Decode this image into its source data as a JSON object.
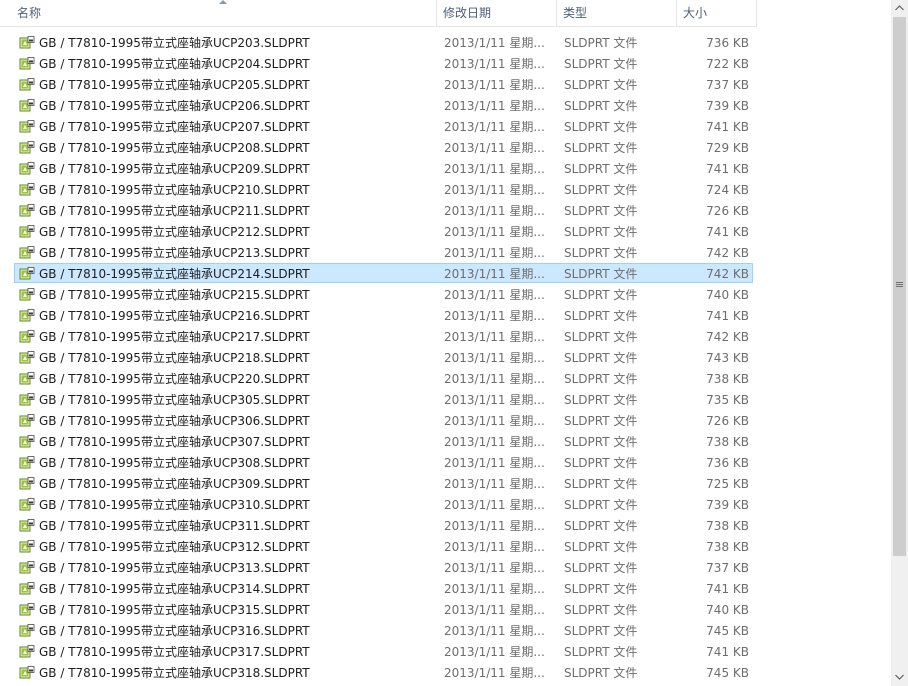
{
  "header": {
    "name": "名称",
    "date": "修改日期",
    "type": "类型",
    "size": "大小"
  },
  "selected_index": 11,
  "icon": "sldprt-file-icon",
  "files": [
    {
      "name": "GB / T7810-1995带立式座轴承UCP203.SLDPRT",
      "date": "2013/1/11 星期...",
      "type": "SLDPRT 文件",
      "size": "736 KB"
    },
    {
      "name": "GB / T7810-1995带立式座轴承UCP204.SLDPRT",
      "date": "2013/1/11 星期...",
      "type": "SLDPRT 文件",
      "size": "722 KB"
    },
    {
      "name": "GB / T7810-1995带立式座轴承UCP205.SLDPRT",
      "date": "2013/1/11 星期...",
      "type": "SLDPRT 文件",
      "size": "737 KB"
    },
    {
      "name": "GB / T7810-1995带立式座轴承UCP206.SLDPRT",
      "date": "2013/1/11 星期...",
      "type": "SLDPRT 文件",
      "size": "739 KB"
    },
    {
      "name": "GB / T7810-1995带立式座轴承UCP207.SLDPRT",
      "date": "2013/1/11 星期...",
      "type": "SLDPRT 文件",
      "size": "741 KB"
    },
    {
      "name": "GB / T7810-1995带立式座轴承UCP208.SLDPRT",
      "date": "2013/1/11 星期...",
      "type": "SLDPRT 文件",
      "size": "729 KB"
    },
    {
      "name": "GB / T7810-1995带立式座轴承UCP209.SLDPRT",
      "date": "2013/1/11 星期...",
      "type": "SLDPRT 文件",
      "size": "741 KB"
    },
    {
      "name": "GB / T7810-1995带立式座轴承UCP210.SLDPRT",
      "date": "2013/1/11 星期...",
      "type": "SLDPRT 文件",
      "size": "724 KB"
    },
    {
      "name": "GB / T7810-1995带立式座轴承UCP211.SLDPRT",
      "date": "2013/1/11 星期...",
      "type": "SLDPRT 文件",
      "size": "726 KB"
    },
    {
      "name": "GB / T7810-1995带立式座轴承UCP212.SLDPRT",
      "date": "2013/1/11 星期...",
      "type": "SLDPRT 文件",
      "size": "741 KB"
    },
    {
      "name": "GB / T7810-1995带立式座轴承UCP213.SLDPRT",
      "date": "2013/1/11 星期...",
      "type": "SLDPRT 文件",
      "size": "742 KB"
    },
    {
      "name": "GB / T7810-1995带立式座轴承UCP214.SLDPRT",
      "date": "2013/1/11 星期...",
      "type": "SLDPRT 文件",
      "size": "742 KB"
    },
    {
      "name": "GB / T7810-1995带立式座轴承UCP215.SLDPRT",
      "date": "2013/1/11 星期...",
      "type": "SLDPRT 文件",
      "size": "740 KB"
    },
    {
      "name": "GB / T7810-1995带立式座轴承UCP216.SLDPRT",
      "date": "2013/1/11 星期...",
      "type": "SLDPRT 文件",
      "size": "741 KB"
    },
    {
      "name": "GB / T7810-1995带立式座轴承UCP217.SLDPRT",
      "date": "2013/1/11 星期...",
      "type": "SLDPRT 文件",
      "size": "742 KB"
    },
    {
      "name": "GB / T7810-1995带立式座轴承UCP218.SLDPRT",
      "date": "2013/1/11 星期...",
      "type": "SLDPRT 文件",
      "size": "743 KB"
    },
    {
      "name": "GB / T7810-1995带立式座轴承UCP220.SLDPRT",
      "date": "2013/1/11 星期...",
      "type": "SLDPRT 文件",
      "size": "738 KB"
    },
    {
      "name": "GB / T7810-1995带立式座轴承UCP305.SLDPRT",
      "date": "2013/1/11 星期...",
      "type": "SLDPRT 文件",
      "size": "735 KB"
    },
    {
      "name": "GB / T7810-1995带立式座轴承UCP306.SLDPRT",
      "date": "2013/1/11 星期...",
      "type": "SLDPRT 文件",
      "size": "726 KB"
    },
    {
      "name": "GB / T7810-1995带立式座轴承UCP307.SLDPRT",
      "date": "2013/1/11 星期...",
      "type": "SLDPRT 文件",
      "size": "738 KB"
    },
    {
      "name": "GB / T7810-1995带立式座轴承UCP308.SLDPRT",
      "date": "2013/1/11 星期...",
      "type": "SLDPRT 文件",
      "size": "736 KB"
    },
    {
      "name": "GB / T7810-1995带立式座轴承UCP309.SLDPRT",
      "date": "2013/1/11 星期...",
      "type": "SLDPRT 文件",
      "size": "725 KB"
    },
    {
      "name": "GB / T7810-1995带立式座轴承UCP310.SLDPRT",
      "date": "2013/1/11 星期...",
      "type": "SLDPRT 文件",
      "size": "739 KB"
    },
    {
      "name": "GB / T7810-1995带立式座轴承UCP311.SLDPRT",
      "date": "2013/1/11 星期...",
      "type": "SLDPRT 文件",
      "size": "738 KB"
    },
    {
      "name": "GB / T7810-1995带立式座轴承UCP312.SLDPRT",
      "date": "2013/1/11 星期...",
      "type": "SLDPRT 文件",
      "size": "738 KB"
    },
    {
      "name": "GB / T7810-1995带立式座轴承UCP313.SLDPRT",
      "date": "2013/1/11 星期...",
      "type": "SLDPRT 文件",
      "size": "737 KB"
    },
    {
      "name": "GB / T7810-1995带立式座轴承UCP314.SLDPRT",
      "date": "2013/1/11 星期...",
      "type": "SLDPRT 文件",
      "size": "741 KB"
    },
    {
      "name": "GB / T7810-1995带立式座轴承UCP315.SLDPRT",
      "date": "2013/1/11 星期...",
      "type": "SLDPRT 文件",
      "size": "740 KB"
    },
    {
      "name": "GB / T7810-1995带立式座轴承UCP316.SLDPRT",
      "date": "2013/1/11 星期...",
      "type": "SLDPRT 文件",
      "size": "745 KB"
    },
    {
      "name": "GB / T7810-1995带立式座轴承UCP317.SLDPRT",
      "date": "2013/1/11 星期...",
      "type": "SLDPRT 文件",
      "size": "741 KB"
    },
    {
      "name": "GB / T7810-1995带立式座轴承UCP318.SLDPRT",
      "date": "2013/1/11 星期...",
      "type": "SLDPRT 文件",
      "size": "745 KB"
    }
  ]
}
